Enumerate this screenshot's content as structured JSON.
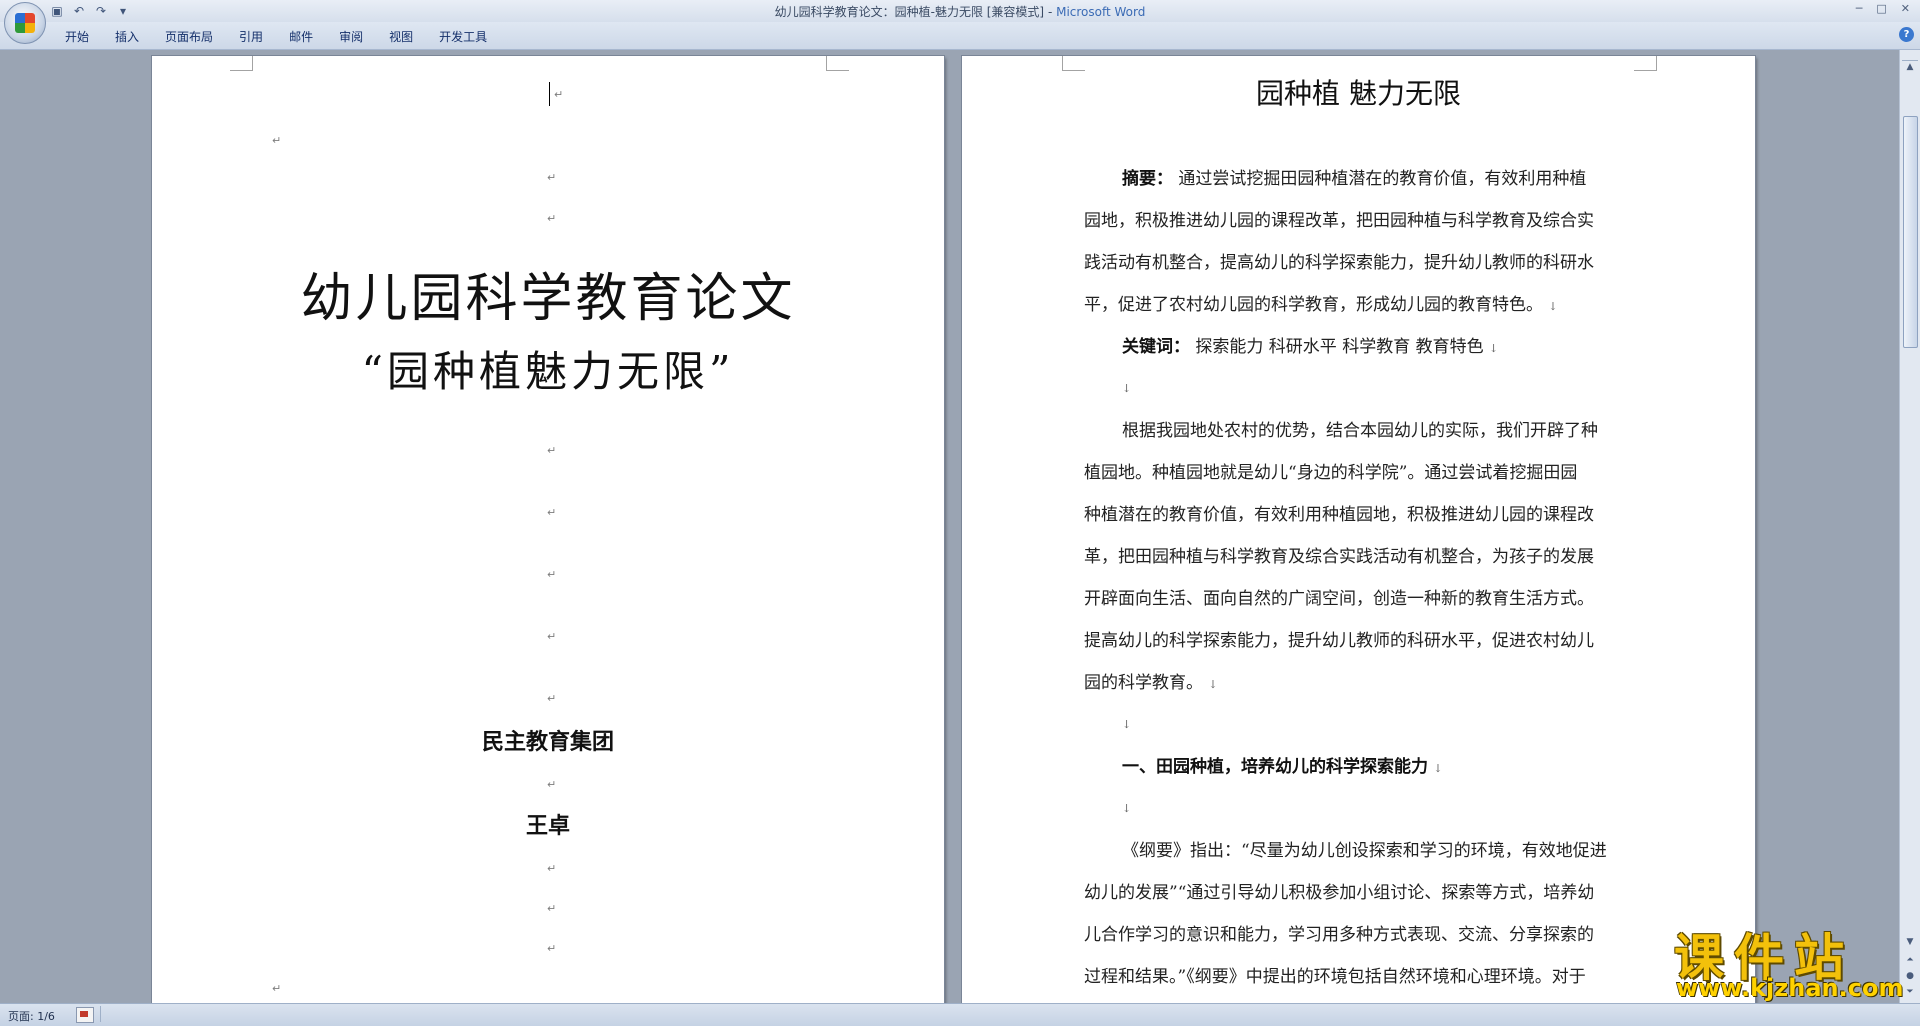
{
  "titlebar": {
    "title": "幼儿园科学教育论文：园种植-魅力无限 [兼容模式]",
    "separator": " - ",
    "app_name": "Microsoft Word",
    "qat": {
      "save_icon": "save-icon",
      "undo_icon": "undo-icon",
      "redo_icon": "redo-icon",
      "customize_icon": "customize-qat-icon"
    },
    "controls": {
      "minimize": "─",
      "maximize": "□",
      "close": "✕"
    }
  },
  "ribbon": {
    "tabs": [
      "开始",
      "插入",
      "页面布局",
      "引用",
      "邮件",
      "审阅",
      "视图",
      "开发工具"
    ],
    "help": "?"
  },
  "page1": {
    "title": "幼儿园科学教育论文",
    "subtitle": "“园种植魅力无限”",
    "org": "民主教育集团",
    "author": "王卓",
    "para_mark": "↵"
  },
  "page2": {
    "heading": "园种植  魅力无限",
    "abstract_label": "摘要：",
    "abstract_lines": [
      "通过尝试挖掘田园种植潜在的教育价值，有效利用种植",
      "园地，积极推进幼儿园的课程改革，把田园种植与科学教育及综合实",
      "践活动有机整合，提高幼儿的科学探索能力，提升幼儿教师的科研水",
      "平，促进了农村幼儿园的科学教育，形成幼儿园的教育特色。"
    ],
    "keywords_label": "关键词：",
    "keywords": "探索能力   科研水平   科学教育   教育特色",
    "intro_lines": [
      "根据我园地处农村的优势，结合本园幼儿的实际，我们开辟了种",
      "植园地。种植园地就是幼儿“身边的科学院”。通过尝试着挖掘田园",
      "种植潜在的教育价值，有效利用种植园地，积极推进幼儿园的课程改",
      "革，把田园种植与科学教育及综合实践活动有机整合，为孩子的发展",
      "开辟面向生活、面向自然的广阔空间，创造一种新的教育生活方式。",
      "提高幼儿的科学探索能力，提升幼儿教师的科研水平，促进农村幼儿",
      "园的科学教育。"
    ],
    "section1_title": "一、田园种植，培养幼儿的科学探索能力",
    "section1_lines": [
      "《纲要》指出：“尽量为幼儿创设探索和学习的环境，有效地促进",
      "幼儿的发展”“通过引导幼儿积极参加小组讨论、探索等方式，培养幼",
      "儿合作学习的意识和能力，学习用多种方式表现、交流、分享探索的",
      "过程和结果。”《纲要》中提出的环境包括自然环境和心理环境。对于"
    ],
    "line_break_mark": "↓"
  },
  "statusbar": {
    "page_info": "页面: 1/6"
  },
  "watermark": {
    "main": "课件站",
    "url": "www.kjzhan.com"
  }
}
